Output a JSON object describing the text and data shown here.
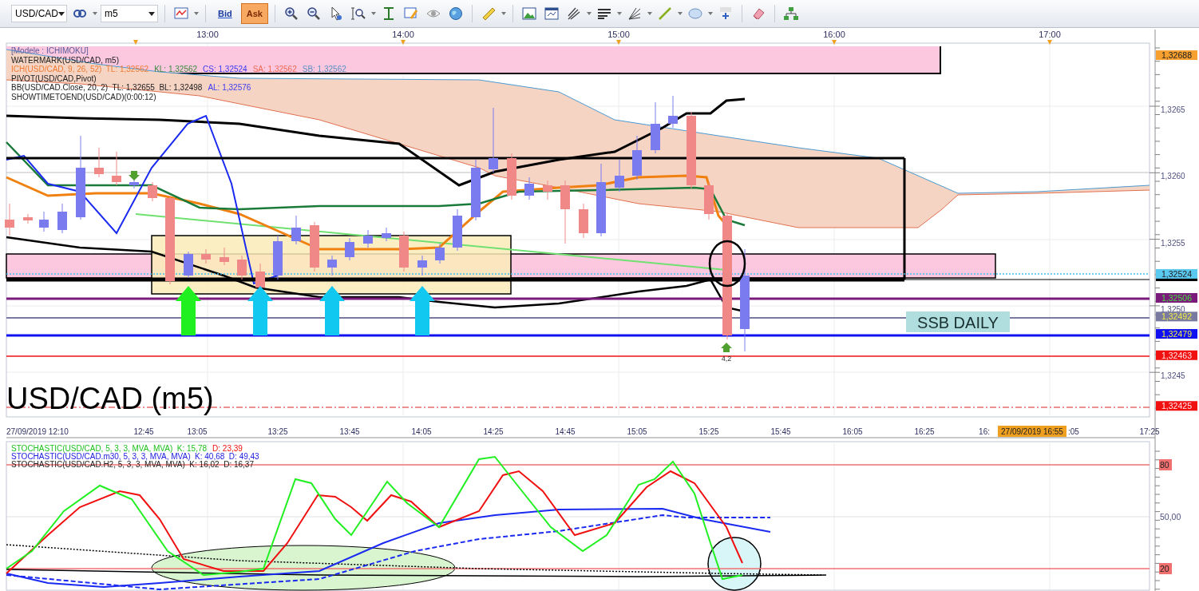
{
  "toolbar": {
    "symbol": "USD/CAD",
    "timeframe": "m5",
    "price_buttons": [
      {
        "label": "Bid",
        "selected": false
      },
      {
        "label": "Ask",
        "selected": true
      }
    ]
  },
  "top_time_axis": [
    "13:00",
    "14:00",
    "15:00",
    "16:00",
    "17:00"
  ],
  "legend": [
    {
      "segments": [
        {
          "text": "[Modele : ICHIMOKU]",
          "color": "#5a5a9a"
        }
      ]
    },
    {
      "segments": [
        {
          "text": "WATERMARK(USD/CAD, m5)",
          "color": "#202020"
        }
      ]
    },
    {
      "segments": [
        {
          "text": "ICH(USD/CAD, 9, 26, 52)  TL: 1,32562",
          "color": "#f07a30"
        },
        {
          "text": "KL: 1,32562",
          "color": "#3a8a3a"
        },
        {
          "text": "CS: 1,32524",
          "color": "#3a3af0"
        },
        {
          "text": "SA: 1,32562",
          "color": "#f06a50"
        },
        {
          "text": "SB: 1,32562",
          "color": "#5a90c0"
        }
      ]
    },
    {
      "segments": [
        {
          "text": "PIVOT(USD/CAD,Pivot)",
          "color": "#202020"
        }
      ]
    },
    {
      "segments": [
        {
          "text": "BB(USD/CAD.Close, 20, 2)  TL: 1,32655  BL: 1,32498",
          "color": "#202020"
        },
        {
          "text": "AL: 1,32576",
          "color": "#3a3af0"
        }
      ]
    },
    {
      "segments": [
        {
          "text": "SHOWTIMETOEND(USD/CAD)(0:00:12)",
          "color": "#202020"
        }
      ]
    }
  ],
  "title": "USD/CAD (m5)",
  "ssb_label": "SSB DAILY",
  "bar_label": "4,2",
  "price_axis": {
    "ticks": [
      "1,3265",
      "1,3260",
      "1,3255",
      "1,3250",
      "1,3245"
    ],
    "markers": [
      {
        "text": "1,32688",
        "color": "#f7a030"
      },
      {
        "text": "1,32524",
        "color": "#5bc8f0"
      },
      {
        "text": "1,32506",
        "color": "#7a1a7a"
      },
      {
        "text": "1,32492",
        "color": "#7a7aa0"
      },
      {
        "text": "1,32479",
        "color": "#1010f0"
      },
      {
        "text": "1,32463",
        "color": "#f01010"
      },
      {
        "text": "1,32425",
        "color": "#f01010"
      }
    ]
  },
  "time_axis": {
    "labels": [
      "27/09/2019 12:10",
      "12:45",
      "13:05",
      "13:25",
      "13:45",
      "14:05",
      "14:25",
      "14:45",
      "15:05",
      "15:25",
      "15:45",
      "16:05",
      "16:25",
      "16:",
      ":05",
      "17:25"
    ],
    "cursor_label": "27/09/2019 16:55"
  },
  "stochastic": {
    "legend": [
      {
        "segments": [
          {
            "text": "STOCHASTIC(USD/CAD, 5, 3, 3, MVA, MVA)  K: 15,78",
            "color": "#20c020"
          },
          {
            "text": "D: 23,39",
            "color": "#f01010"
          }
        ]
      },
      {
        "segments": [
          {
            "text": "STOCHASTIC(USD/CAD.m30, 5, 3, 3, MVA, MVA)  K: 40,68  D: 49,43",
            "color": "#2020e0"
          }
        ]
      },
      {
        "segments": [
          {
            "text": "STOCHASTIC(USD/CAD.H2, 5, 3, 3, MVA, MVA)  K: 16,02  D: 16,37",
            "color": "#202020"
          }
        ]
      }
    ],
    "levels": [
      {
        "text": "80",
        "color": "#f07070"
      },
      {
        "text": "50,00"
      },
      {
        "text": "20",
        "color": "#f07070"
      }
    ]
  }
}
